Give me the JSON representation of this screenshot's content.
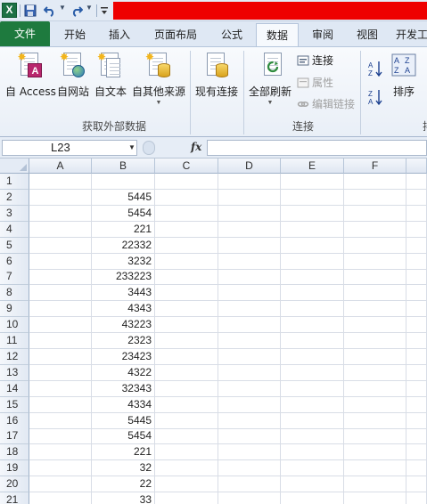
{
  "qat": {
    "logo": "X",
    "save_icon": "save-icon",
    "undo_icon": "undo-icon",
    "redo_icon": "redo-icon"
  },
  "tabs": [
    {
      "label": "文件"
    },
    {
      "label": "开始"
    },
    {
      "label": "插入"
    },
    {
      "label": "页面布局"
    },
    {
      "label": "公式"
    },
    {
      "label": "数据"
    },
    {
      "label": "审阅"
    },
    {
      "label": "视图"
    },
    {
      "label": "开发工"
    }
  ],
  "ribbon": {
    "get_external": {
      "group_label": "获取外部数据",
      "access": "自 Access",
      "web": "自网站",
      "text": "自文本",
      "other": "自其他来源",
      "existing": "现有连接"
    },
    "connections": {
      "group_label": "连接",
      "refresh_all": "全部刷新",
      "connections": "连接",
      "properties": "属性",
      "edit_links": "编辑链接"
    },
    "sort": {
      "sort_label": "排序",
      "group_label_partial": "排"
    }
  },
  "formula_bar": {
    "name_box": "L23",
    "fx": "fx",
    "formula": ""
  },
  "grid": {
    "columns": [
      "A",
      "B",
      "C",
      "D",
      "E",
      "F"
    ],
    "rows": [
      {
        "num": "1",
        "B": ""
      },
      {
        "num": "2",
        "B": "5445"
      },
      {
        "num": "3",
        "B": "5454"
      },
      {
        "num": "4",
        "B": "221"
      },
      {
        "num": "5",
        "B": "22332"
      },
      {
        "num": "6",
        "B": "3232"
      },
      {
        "num": "7",
        "B": "233223"
      },
      {
        "num": "8",
        "B": "3443"
      },
      {
        "num": "9",
        "B": "4343"
      },
      {
        "num": "10",
        "B": "43223"
      },
      {
        "num": "11",
        "B": "2323"
      },
      {
        "num": "12",
        "B": "23423"
      },
      {
        "num": "13",
        "B": "4322"
      },
      {
        "num": "14",
        "B": "32343"
      },
      {
        "num": "15",
        "B": "4334"
      },
      {
        "num": "16",
        "B": "5445"
      },
      {
        "num": "17",
        "B": "5454"
      },
      {
        "num": "18",
        "B": "221"
      },
      {
        "num": "19",
        "B": "32"
      },
      {
        "num": "20",
        "B": "22"
      },
      {
        "num": "21",
        "B": "33"
      }
    ]
  }
}
